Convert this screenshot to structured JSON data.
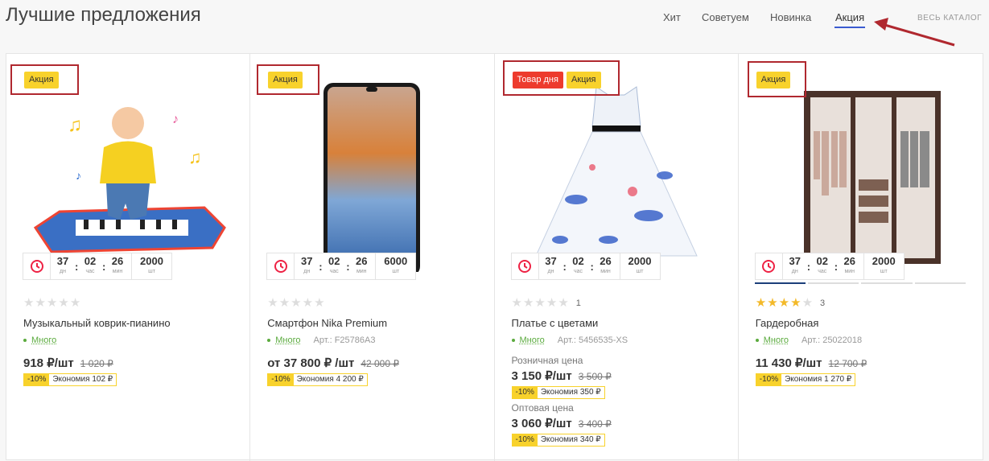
{
  "header": {
    "title": "Лучшие предложения",
    "tabs": [
      "Хит",
      "Советуем",
      "Новинка",
      "Акция"
    ],
    "active_tab": "Акция",
    "catalog_link": "ВЕСЬ КАТАЛОГ"
  },
  "colors": {
    "accent": "#3a5bd0",
    "sale_badge": "#f8d22c",
    "day_badge": "#ed3b2d",
    "stock": "#5bab3e",
    "annotation": "#b0282f"
  },
  "timer_units": {
    "days": "дн",
    "hours": "час",
    "minutes": "мин",
    "pieces": "шт"
  },
  "products": [
    {
      "badges": [
        "Акция"
      ],
      "timer": {
        "d": "37",
        "h": "02",
        "m": "26",
        "qty": "2000"
      },
      "rating_stars": 0,
      "rating_count": "",
      "name": "Музыкальный коврик-пианино",
      "stock": "Много",
      "article": "",
      "price": "918 ₽/шт",
      "old_price": "1 020 ₽",
      "discount": "-10%",
      "economy": "Экономия 102 ₽",
      "image_icon": "baby-piano-mat-image"
    },
    {
      "badges": [
        "Акция"
      ],
      "timer": {
        "d": "37",
        "h": "02",
        "m": "26",
        "qty": "6000"
      },
      "rating_stars": 0,
      "rating_count": "",
      "name": "Смартфон Nika Premium",
      "stock": "Много",
      "article": "Арт.: F25786A3",
      "price": "от 37 800 ₽ /шт",
      "old_price": "42 000 ₽",
      "discount": "-10%",
      "economy": "Экономия 4 200 ₽",
      "image_icon": "smartphone-image"
    },
    {
      "badges": [
        "Товар дня",
        "Акция"
      ],
      "timer": {
        "d": "37",
        "h": "02",
        "m": "26",
        "qty": "2000"
      },
      "rating_stars": 0,
      "rating_count": "1",
      "name": "Платье с цветами",
      "stock": "Много",
      "article": "Арт.: 5456535-XS",
      "retail_label": "Розничная цена",
      "price": "3 150 ₽/шт",
      "old_price": "3 500 ₽",
      "discount": "-10%",
      "economy": "Экономия 350 ₽",
      "wholesale_label": "Оптовая цена",
      "price2": "3 060 ₽/шт",
      "old_price2": "3 400 ₽",
      "discount2": "-10%",
      "economy2": "Экономия 340 ₽",
      "image_icon": "floral-dress-image"
    },
    {
      "badges": [
        "Акция"
      ],
      "timer": {
        "d": "37",
        "h": "02",
        "m": "26",
        "qty": "2000"
      },
      "rating_stars": 4,
      "rating_count": "3",
      "name": "Гардеробная",
      "stock": "Много",
      "article": "Арт.: 25022018",
      "price": "11 430 ₽/шт",
      "old_price": "12 700 ₽",
      "discount": "-10%",
      "economy": "Экономия 1 270 ₽",
      "image_icon": "wardrobe-image"
    }
  ]
}
